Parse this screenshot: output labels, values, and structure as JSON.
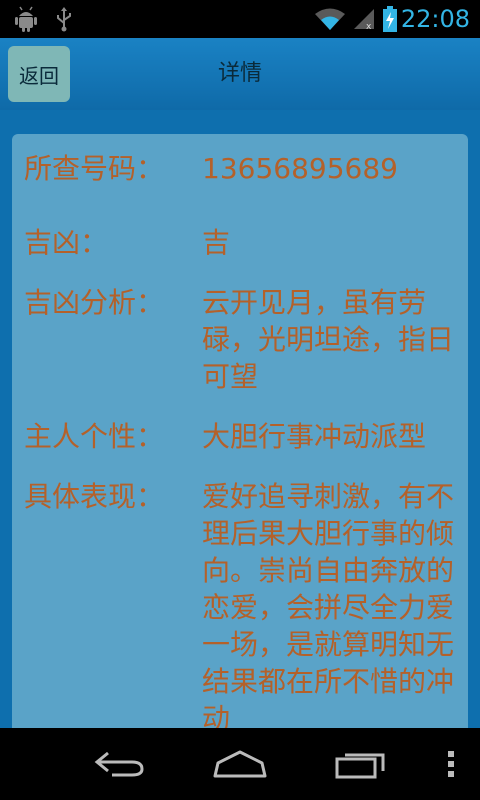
{
  "status_bar": {
    "time": "22:08",
    "icons": [
      "android-debug-icon",
      "usb-icon",
      "wifi-icon",
      "signal-icon",
      "battery-charging-icon"
    ]
  },
  "header": {
    "back_label": "返回",
    "title": "详情"
  },
  "details": [
    {
      "label": "所查号码：",
      "value": "13656895689"
    },
    {
      "label": "吉凶：",
      "value": "吉"
    },
    {
      "label": "吉凶分析：",
      "value": "云开见月，虽有劳碌，光明坦途，指日可望"
    },
    {
      "label": "主人个性：",
      "value": "大胆行事冲动派型"
    },
    {
      "label": "具体表现：",
      "value": "爱好追寻刺激，有不理后果大胆行事的倾向。崇尚自由奔放的恋爱，会拼尽全力爱一场，是就算明知无结果都在所不惜的冲动"
    }
  ],
  "nav_bar": {
    "icons": [
      "back-nav-icon",
      "home-nav-icon",
      "recents-nav-icon",
      "overflow-menu-icon"
    ]
  },
  "colors": {
    "background": "#0e6fae",
    "card": "#5aa3c8",
    "text": "#b4612a",
    "accent": "#33b5e5"
  }
}
